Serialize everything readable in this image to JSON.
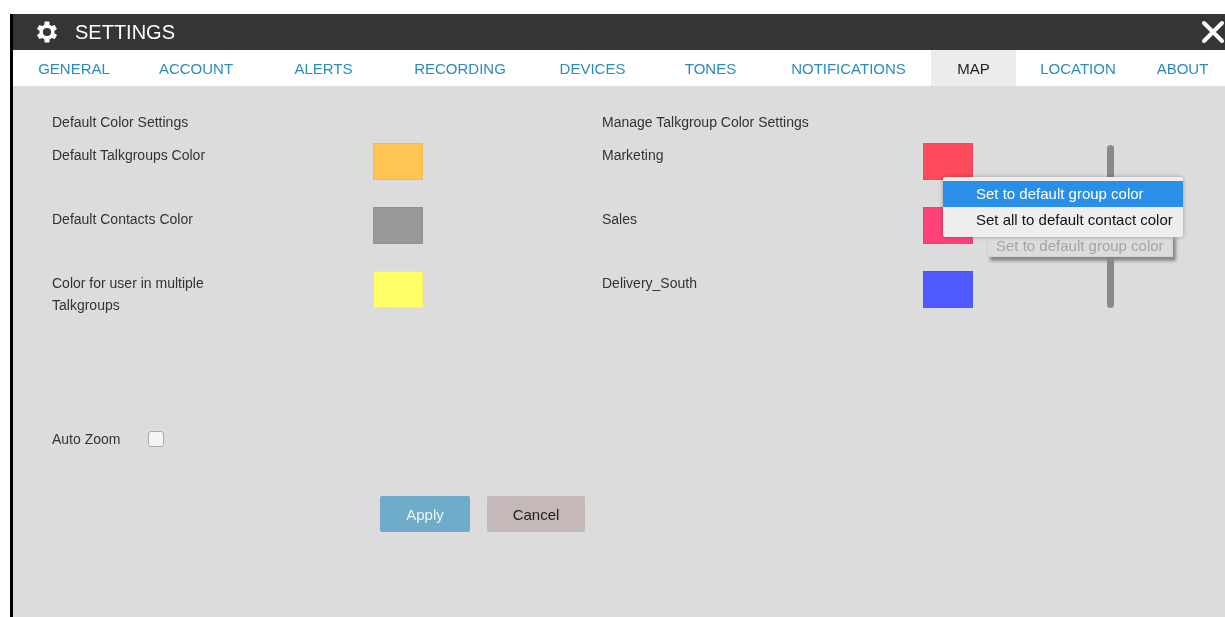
{
  "window": {
    "title": "SETTINGS"
  },
  "tabs": [
    {
      "label": "GENERAL",
      "selected": false
    },
    {
      "label": "ACCOUNT",
      "selected": false
    },
    {
      "label": "ALERTS",
      "selected": false
    },
    {
      "label": "RECORDING",
      "selected": false
    },
    {
      "label": "DEVICES",
      "selected": false
    },
    {
      "label": "TONES",
      "selected": false
    },
    {
      "label": "NOTIFICATIONS",
      "selected": false
    },
    {
      "label": "MAP",
      "selected": true
    },
    {
      "label": "LOCATION",
      "selected": false
    },
    {
      "label": "ABOUT",
      "selected": false
    }
  ],
  "default_colors": {
    "heading": "Default Color Settings",
    "rows": [
      {
        "label": "Default Talkgroups Color",
        "color": "#ffc452"
      },
      {
        "label": "Default Contacts Color",
        "color": "#999999"
      },
      {
        "label": "Color for user in multiple Talkgroups",
        "color": "#ffff66"
      }
    ]
  },
  "talkgroup_colors": {
    "heading": "Manage Talkgroup Color Settings",
    "rows": [
      {
        "label": "Marketing",
        "color": "#ff4a5e"
      },
      {
        "label": "Sales",
        "color": "#ff437a"
      },
      {
        "label": "Delivery_South",
        "color": "#5059ff"
      }
    ]
  },
  "auto_zoom": {
    "label": "Auto Zoom",
    "checked": false
  },
  "buttons": {
    "apply": "Apply",
    "cancel": "Cancel"
  },
  "context_menu": [
    {
      "label": "Set to default group color",
      "selected": true
    },
    {
      "label": "Set all to default contact color",
      "selected": false
    }
  ],
  "faded_tooltip": "Set to default group color"
}
